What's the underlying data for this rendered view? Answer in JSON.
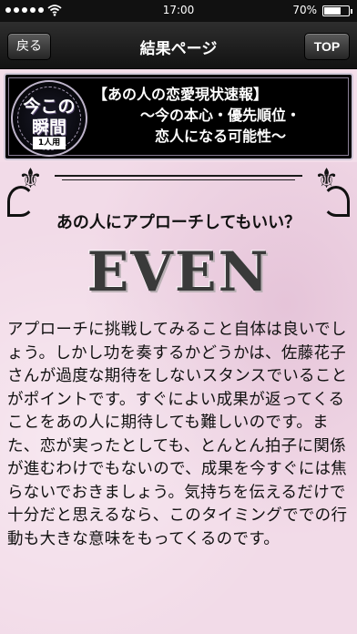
{
  "status_bar": {
    "time": "17:00",
    "battery_percent": "70%",
    "battery_level": 0.7
  },
  "nav": {
    "back_label": "戻る",
    "title": "結果ページ",
    "top_label": "TOP"
  },
  "banner": {
    "seal_line1": "今この",
    "seal_line2": "瞬間",
    "seal_badge": "1人用",
    "line1": "【あの人の恋愛現状速報】",
    "line2": "〜今の本心・優先順位・",
    "line3": "恋人になる可能性〜"
  },
  "result": {
    "question": "あの人にアプローチしてもいい？",
    "verdict": "EVEN",
    "body": "アプローチに挑戦してみること自体は良いでしょう。しかし功を奏するかどうかは、佐藤花子さんが過度な期待をしないスタンスでいることがポイントです。すぐによい成果が返ってくることをあの人に期待しても難しいのです。また、恋が実ったとしても、とんとん拍子に関係が進むわけでもないので、成果を今すぐには焦らないでおきましょう。気持ちを伝えるだけで十分だと思えるなら、このタイミングででの行動も大きな意味をもってくるのです。"
  },
  "colors": {
    "nav_bg": "#1c1c1c",
    "content_bg": "#f2dbe8",
    "banner_bg": "#000000"
  }
}
